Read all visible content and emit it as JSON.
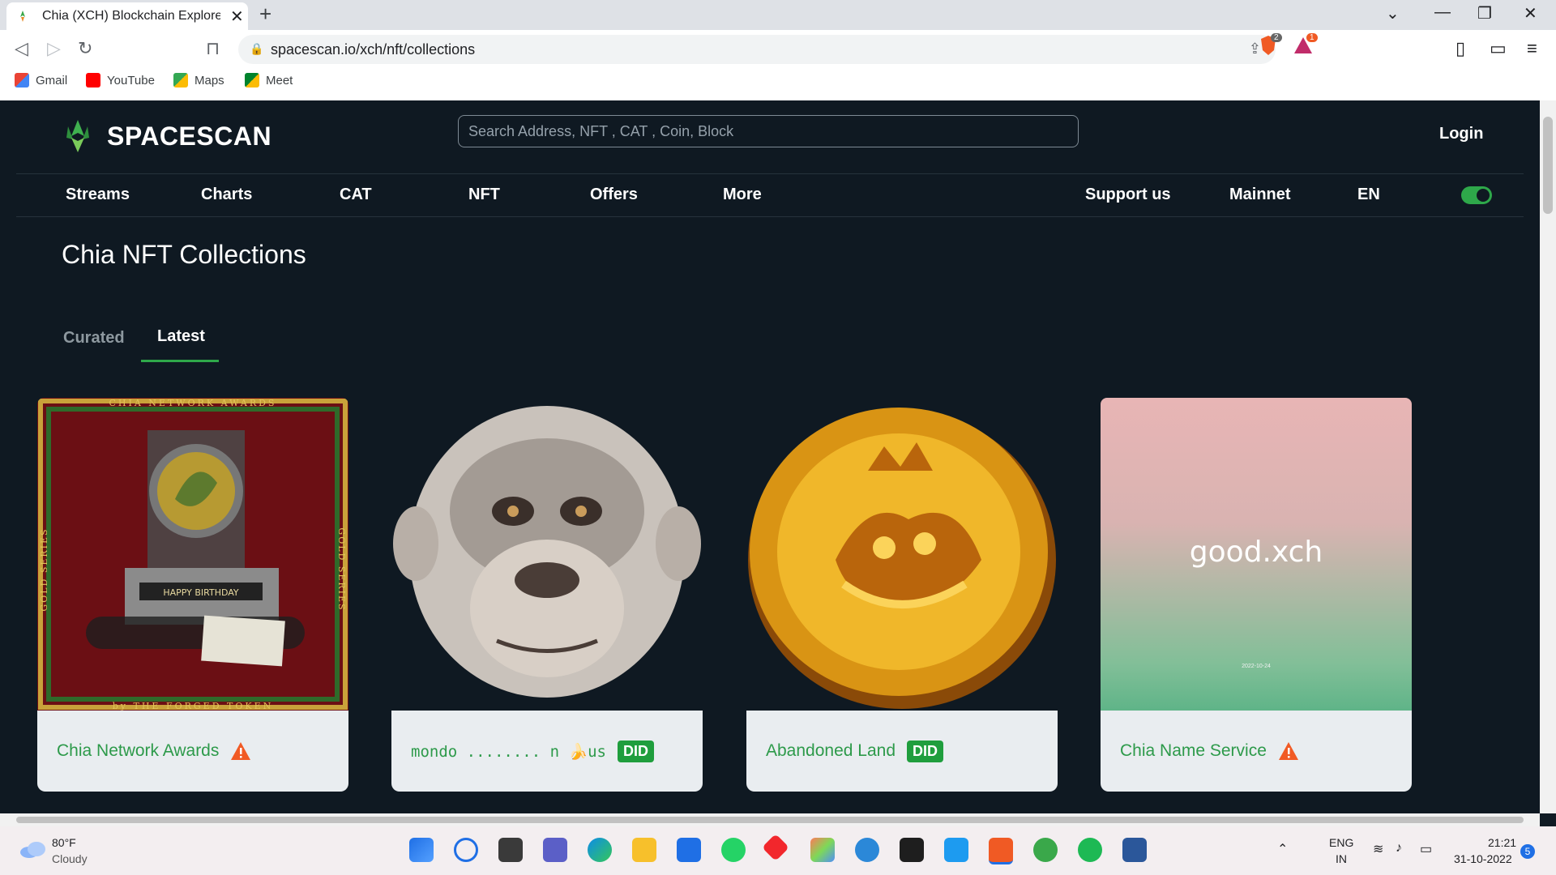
{
  "browser": {
    "tab_title": "Chia (XCH) Blockchain Explorer | C",
    "url": "spacescan.io/xch/nft/collections",
    "bookmarks": [
      "Gmail",
      "YouTube",
      "Maps",
      "Meet"
    ],
    "brave_badge": "2",
    "rewards_badge": "1"
  },
  "site": {
    "logo_text": "SPACESCAN",
    "search_placeholder": "Search Address, NFT , CAT , Coin, Block",
    "login": "Login",
    "nav": [
      "Streams",
      "Charts",
      "CAT",
      "NFT",
      "Offers",
      "More"
    ],
    "nav_right": [
      "Support us",
      "Mainnet",
      "EN"
    ],
    "page_title": "Chia NFT Collections",
    "tabs": [
      "Curated",
      "Latest"
    ],
    "active_tab": "Latest",
    "accent": "#2ea84a",
    "cards": [
      {
        "name": "Chia Network Awards",
        "marker": "warning-icon"
      },
      {
        "name": "mondo ........ n 🍌us",
        "marker": "DID"
      },
      {
        "name": "Abandoned Land",
        "marker": "DID"
      },
      {
        "name": "Chia Name Service",
        "marker": "warning-icon"
      }
    ],
    "card1_image": {
      "top_text": "CHIA NETWORK AWARDS",
      "bottom_text": "by THE FORGED TOKEN",
      "side_text": "GOLD SERIES",
      "plaque": "HAPPY BIRTHDAY"
    },
    "card4_image": {
      "title": "good.xch",
      "date": "2022-10-24"
    }
  },
  "taskbar": {
    "weather_temp": "80°F",
    "weather_desc": "Cloudy",
    "lang": "ENG",
    "region": "IN",
    "time": "21:21",
    "date": "31-10-2022",
    "notifications": "5"
  }
}
